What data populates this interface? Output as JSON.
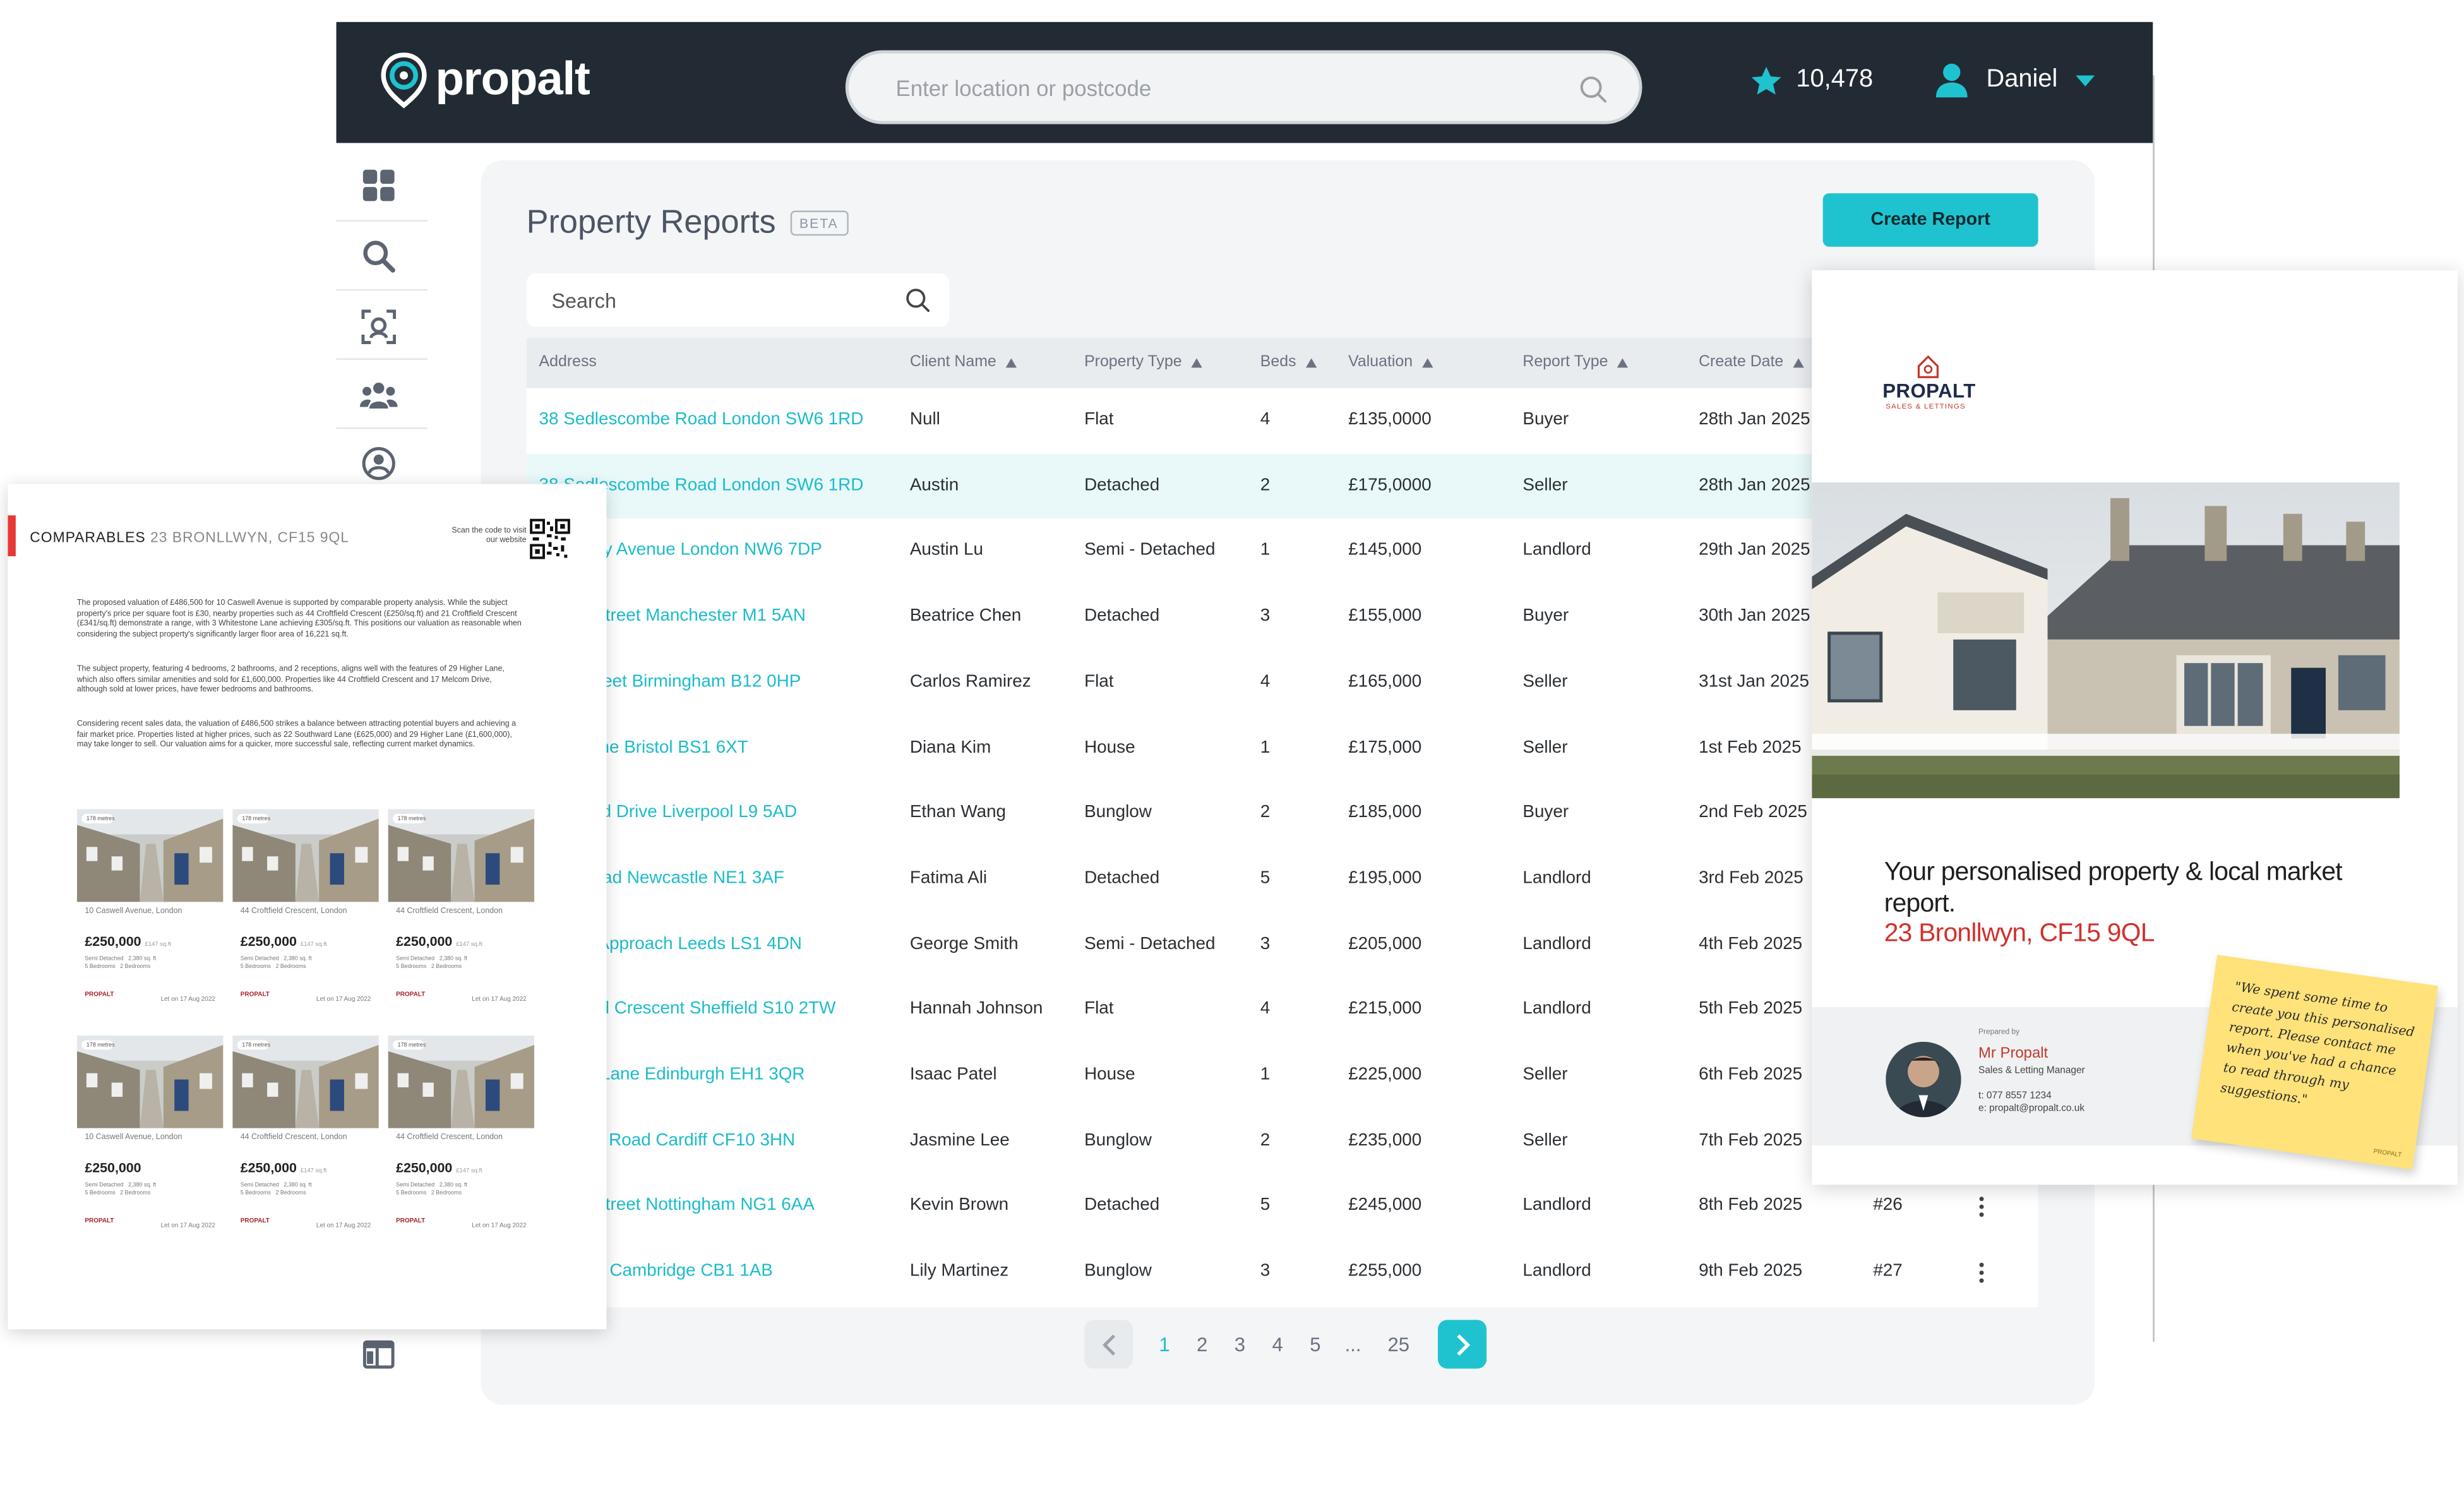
{
  "app": {
    "logo_text": "propalt",
    "search_placeholder": "Enter location or postcode",
    "rating": "10,478",
    "user_name": "Daniel"
  },
  "sidebar": {
    "items": [
      "dashboard-icon",
      "search-icon",
      "scan-icon",
      "team-icon",
      "profile-icon",
      "layout-icon"
    ]
  },
  "page": {
    "title": "Property Reports",
    "badge": "BETA",
    "create_button": "Create Report",
    "search_placeholder": "Search"
  },
  "table": {
    "columns": [
      "Address",
      "Client Name",
      "Property Type",
      "Beds",
      "Valuation",
      "Report Type",
      "Create Date"
    ],
    "rows": [
      {
        "address": "38 Sedlescombe Road London SW6 1RD",
        "client": "Null",
        "type": "Flat",
        "beds": "4",
        "valuation": "£135,0000",
        "report_type": "Buyer",
        "date": "28th Jan 2025",
        "id": ""
      },
      {
        "address": "38 Sedlescombe Road London SW6 1RD",
        "client": "Austin",
        "type": "Detached",
        "beds": "2",
        "valuation": "£175,0000",
        "report_type": "Seller",
        "date": "28th Jan 2025",
        "id": ""
      },
      {
        "address": "Mossway Avenue London NW6 7DP",
        "client": "Austin Lu",
        "type": "Semi - Detached",
        "beds": "1",
        "valuation": "£145,000",
        "report_type": "Landlord",
        "date": "29th Jan 2025",
        "id": ""
      },
      {
        "address": "Castle Street Manchester M1 5AN",
        "client": "Beatrice Chen",
        "type": "Detached",
        "beds": "3",
        "valuation": "£155,000",
        "report_type": "Buyer",
        "date": "30th Jan 2025",
        "id": ""
      },
      {
        "address": "High Street Birmingham B12 0HP",
        "client": "Carlos Ramirez",
        "type": "Flat",
        "beds": "4",
        "valuation": "£165,000",
        "report_type": "Seller",
        "date": "31st Jan 2025",
        "id": ""
      },
      {
        "address": "Park Lane Bristol BS1 6XT",
        "client": "Diana Kim",
        "type": "House",
        "beds": "1",
        "valuation": "£175,000",
        "report_type": "Seller",
        "date": "1st Feb 2025",
        "id": ""
      },
      {
        "address": "Elmwood Drive Liverpool L9 5AD",
        "client": "Ethan Wang",
        "type": "Bunglow",
        "beds": "2",
        "valuation": "£185,000",
        "report_type": "Buyer",
        "date": "2nd Feb 2025",
        "id": ""
      },
      {
        "address": "Park Road Newcastle NE1 3AF",
        "client": "Fatima Ali",
        "type": "Detached",
        "beds": "5",
        "valuation": "£195,000",
        "report_type": "Landlord",
        "date": "3rd Feb 2025",
        "id": ""
      },
      {
        "address": "Station Approach Leeds LS1 4DN",
        "client": "George Smith",
        "type": "Semi - Detached",
        "beds": "3",
        "valuation": "£205,000",
        "report_type": "Landlord",
        "date": "4th Feb 2025",
        "id": ""
      },
      {
        "address": "Croftfield Crescent Sheffield S10 2TW",
        "client": "Hannah Johnson",
        "type": "Flat",
        "beds": "4",
        "valuation": "£215,000",
        "report_type": "Landlord",
        "date": "5th Feb 2025",
        "id": ""
      },
      {
        "address": "Church Lane Edinburgh EH1 3QR",
        "client": "Isaac Patel",
        "type": "House",
        "beds": "1",
        "valuation": "£225,000",
        "report_type": "Seller",
        "date": "6th Feb 2025",
        "id": ""
      },
      {
        "address": "Queen's Road Cardiff CF10 3HN",
        "client": "Jasmine Lee",
        "type": "Bunglow",
        "beds": "2",
        "valuation": "£235,000",
        "report_type": "Seller",
        "date": "7th Feb 2025",
        "id": ""
      },
      {
        "address": "Castle Street Nottingham NG1 6AA",
        "client": "Kevin Brown",
        "type": "Detached",
        "beds": "5",
        "valuation": "£245,000",
        "report_type": "Landlord",
        "date": "8th Feb 2025",
        "id": "#26"
      },
      {
        "address": "Mill Way Cambridge CB1 1AB",
        "client": "Lily Martinez",
        "type": "Bunglow",
        "beds": "3",
        "valuation": "£255,000",
        "report_type": "Landlord",
        "date": "9th Feb 2025",
        "id": "#27"
      }
    ]
  },
  "pagination": {
    "pages": [
      "1",
      "2",
      "3",
      "4",
      "5",
      "...",
      "25"
    ],
    "current": "1"
  },
  "comparables_doc": {
    "title": "COMPARABLES",
    "address": "23 BRONLLWYN, CF15 9QL",
    "scan_text": "Scan the code to visit our website",
    "paragraphs": [
      "The proposed valuation of £486,500 for 10 Caswell Avenue is supported by comparable property analysis. While the subject property's price per square foot is £30, nearby properties such as 44 Croftfield Crescent (£250/sq.ft) and 21 Croftfield Crescent (£341/sq.ft) demonstrate a range, with 3 Whitestone Lane achieving £305/sq.ft. This positions our valuation as reasonable when considering the subject property's significantly larger floor area of 16,221 sq.ft.",
      "The subject property, featuring 4 bedrooms, 2 bathrooms, and 2 receptions, aligns well with the features of 29 Higher Lane, which also offers similar amenities and sold for £1,600,000. Properties like 44 Croftfield Crescent and 17 Melcom Drive, although sold at lower prices, have fewer bedrooms and bathrooms.",
      "Considering recent sales data, the valuation of £486,500 strikes a balance between attracting potential buyers and achieving a fair market price. Properties listed at higher prices, such as 22 Southward Lane (£625,000) and 29 Higher Lane (£1,600,000), may take longer to sell. Our valuation aims for a quicker, more successful sale, reflecting current market dynamics."
    ],
    "cards": [
      {
        "tag": "178 metres",
        "address": "10 Caswell Avenue, London",
        "price": "£250,000",
        "ppsf": "£147 sq.ft",
        "type": "Semi Detached",
        "sqft": "2,380 sq. ft",
        "beds": "5 Bedrooms",
        "baths": "2 Bedrooms",
        "logo": "PROPALT",
        "listed": "Let on 17 Aug 2022"
      },
      {
        "tag": "178 metres",
        "address": "44 Croftfield Crescent, London",
        "price": "£250,000",
        "ppsf": "£147 sq.ft",
        "type": "Semi Detached",
        "sqft": "2,380 sq. ft",
        "beds": "5 Bedrooms",
        "baths": "2 Bedrooms",
        "logo": "PROPALT",
        "listed": "Let on 17 Aug 2022"
      },
      {
        "tag": "178 metres",
        "address": "44 Croftfield Crescent, London",
        "price": "£250,000",
        "ppsf": "£147 sq.ft",
        "type": "Semi Detached",
        "sqft": "2,380 sq. ft",
        "beds": "5 Bedrooms",
        "baths": "2 Bedrooms",
        "logo": "PROPALT",
        "listed": "Let on 17 Aug 2022"
      },
      {
        "tag": "178 metres",
        "address": "10 Caswell Avenue, London",
        "price": "£250,000",
        "ppsf": "",
        "type": "Semi Detached",
        "sqft": "2,380 sq. ft",
        "beds": "5 Bedrooms",
        "baths": "2 Bedrooms",
        "logo": "PROPALT",
        "listed": "Let on 17 Aug 2022"
      },
      {
        "tag": "178 metres",
        "address": "44 Croftfield Crescent, London",
        "price": "£250,000",
        "ppsf": "£147 sq.ft",
        "type": "Semi Detached",
        "sqft": "2,380 sq. ft",
        "beds": "5 Bedrooms",
        "baths": "2 Bedrooms",
        "logo": "PROPALT",
        "listed": "Let on 17 Aug 2022"
      },
      {
        "tag": "178 metres",
        "address": "44 Croftfield Crescent, London",
        "price": "£250,000",
        "ppsf": "£147 sq.ft",
        "type": "Semi Detached",
        "sqft": "2,380 sq. ft",
        "beds": "5 Bedrooms",
        "baths": "2 Bedrooms",
        "logo": "PROPALT",
        "listed": "Let on 17 Aug 2022"
      }
    ]
  },
  "report_doc": {
    "brand": "PROPALT",
    "brand_sub": "SALES & LETTINGS",
    "heading": "Your personalised property & local market report.",
    "address": "23 Bronllwyn, CF15 9QL",
    "prepared_by": "Prepared by",
    "agent_name": "Mr Propalt",
    "agent_role": "Sales & Letting Manager",
    "agent_tel": "t: 077 8557 1234",
    "agent_email": "e: propalt@propalt.co.uk",
    "note": "\"We spent some time to create you this personalised report. Please contact me when you've had a chance to read through my suggestions.\"",
    "note_mark": "PROPALT"
  },
  "colors": {
    "header_bg": "#222b34",
    "accent": "#1fc3cf",
    "link": "#1cbccb",
    "brand_red": "#d0312d",
    "sticky": "#ffe27a"
  }
}
